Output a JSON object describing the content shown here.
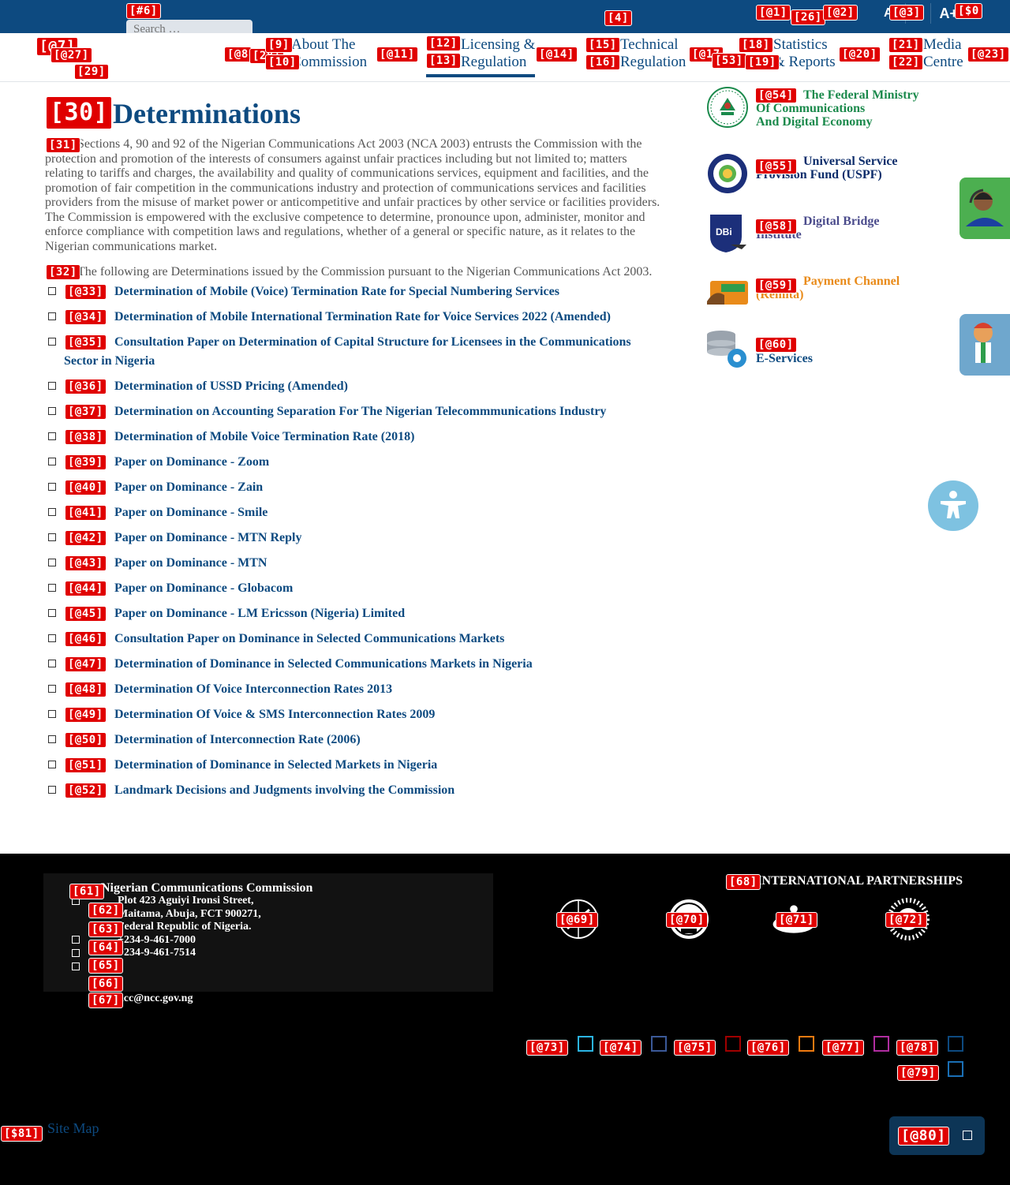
{
  "header": {
    "search_placeholder": "Search …",
    "font_controls": [
      "A-",
      "A",
      "A+"
    ]
  },
  "nav": {
    "items": [
      {
        "line1": "About The",
        "line2": "Commission"
      },
      {
        "line1": "Licensing &",
        "line2": "Regulation"
      },
      {
        "line1": "Technical",
        "line2": "Regulation"
      },
      {
        "line1": "Statistics",
        "line2": "& Reports"
      },
      {
        "line1": "Media",
        "line2": "Centre"
      }
    ]
  },
  "main": {
    "title": "Determinations",
    "intro": "Sections 4, 90 and 92 of the Nigerian Communications Act 2003 (NCA 2003) entrusts the Commission with the protection and promotion of the interests of consumers against unfair practices including but not limited to; matters relating to tariffs and charges, the availability and quality of communications services, equipment and facilities, and the promotion of fair competition in the communications industry and protection of communications services and facilities providers from the misuse of market power or anticompetitive and unfair practices by other service or facilities providers. The Commission is empowered with the exclusive competence to determine, pronounce upon, administer, monitor and enforce compliance with competition laws and regulations, whether of a general or specific nature, as it relates to the Nigerian communications market.",
    "lead": "The following are Determinations issued by the Commission pursuant to the Nigerian Communications Act 2003.",
    "documents": [
      "Determination of Mobile (Voice) Termination Rate for Special Numbering Services",
      "Determination of Mobile International Termination Rate for Voice Services 2022 (Amended)",
      "Consultation Paper on Determination of Capital Structure for Licensees in the Communications Sector in Nigeria",
      "Determination of USSD Pricing (Amended)",
      "Determination on Accounting Separation For The Nigerian Telecommmunications Industry",
      "Determination of Mobile Voice Termination Rate (2018)",
      "Paper on Dominance - Zoom",
      "Paper on Dominance - Zain",
      "Paper on Dominance - Smile",
      "Paper on Dominance - MTN Reply",
      "Paper on Dominance - MTN",
      "Paper on Dominance - Globacom",
      "Paper on Dominance - LM Ericsson (Nigeria) Limited",
      "Consultation Paper on Dominance in Selected Communications Markets",
      "Determination of Dominance in Selected Communications Markets in Nigeria",
      "Determination Of Voice Interconnection Rates 2013",
      "Determination Of Voice & SMS Interconnection Rates 2009",
      "Determination of Interconnection Rate (2006)",
      "Determination of Dominance in Selected Markets in Nigeria",
      "Landmark Decisions and Judgments involving the Commission"
    ]
  },
  "sidebar": {
    "ministry": {
      "line1": "The Federal Ministry",
      "line2": "Of Communications",
      "line3": "And Digital Economy"
    },
    "uspf": {
      "line1": "Universal Service",
      "line2": "Provision Fund (USPF)"
    },
    "dbi": {
      "line1": "Digital Bridge",
      "line2": "Institute"
    },
    "remita": {
      "line1": "Payment Channel",
      "line2": "(Remita)"
    },
    "eservices": {
      "label": "E-Services"
    }
  },
  "footer": {
    "org": "Nigerian Communications Commission",
    "address": [
      "Plot 423 Aguiyi Ironsi Street,",
      "Maitama, Abuja, FCT 900271,",
      "Federal Republic of Nigeria."
    ],
    "phones": [
      "+234-9-461-7000",
      "+234-9-461-7514"
    ],
    "email": "ncc@ncc.gov.ng",
    "partners_title": "INTERNATIONAL PARTNERSHIPS",
    "sitemap": "Site Map",
    "social_colors": [
      "#2bb5e5",
      "#3b5998",
      "#a00000",
      "#f07a10",
      "#b02da0",
      "#0d4a80",
      "#1a6fb5"
    ]
  },
  "badges": {
    "b6": "[#6]",
    "b1": "[@1]",
    "b26": "[26]",
    "b2": "[@2]",
    "b3": "[@3]",
    "b0": "[$0",
    "b4": "[4]",
    "b7": "[@7]",
    "b27": "[@27]",
    "b29": "[29]",
    "b8": "[@8",
    "b28": "[28]",
    "b9": "[9]",
    "b10": "[10]",
    "b11": "[@11]",
    "b12": "[12]",
    "b13": "[13]",
    "b14": "[@14]",
    "b15": "[15]",
    "b16": "[16]",
    "b17": "[@17",
    "b18": "[18]",
    "b53": "[53]",
    "b19": "[19]",
    "b20": "[@20]",
    "b21": "[21]",
    "b22": "[22]",
    "b23": "[@23]",
    "b30": "[30]",
    "b31": "[31]",
    "b32": "[32]",
    "docs": [
      "[@33]",
      "[@34]",
      "[@35]",
      "[@36]",
      "[@37]",
      "[@38]",
      "[@39]",
      "[@40]",
      "[@41]",
      "[@42]",
      "[@43]",
      "[@44]",
      "[@45]",
      "[@46]",
      "[@47]",
      "[@48]",
      "[@49]",
      "[@50]",
      "[@51]",
      "[@52]"
    ],
    "b54": "[@54]",
    "b55": "[@55]",
    "b58": "[@58]",
    "b59": "[@59]",
    "b60": "[@60]",
    "b61": "[61]",
    "b62": "[62]",
    "b63": "[63]",
    "b64": "[64]",
    "b65": "[65]",
    "b66": "[66]",
    "b67": "[67]",
    "b68": "[68]",
    "b69": "[@69]",
    "b70": "[@70]",
    "b71": "[@71]",
    "b72": "[@72]",
    "b73": "[@73]",
    "b74": "[@74]",
    "b75": "[@75]",
    "b76": "[@76]",
    "b77": "[@77]",
    "b78": "[@78]",
    "b79": "[@79]",
    "b80": "[@80]",
    "b81": "[$81]"
  }
}
